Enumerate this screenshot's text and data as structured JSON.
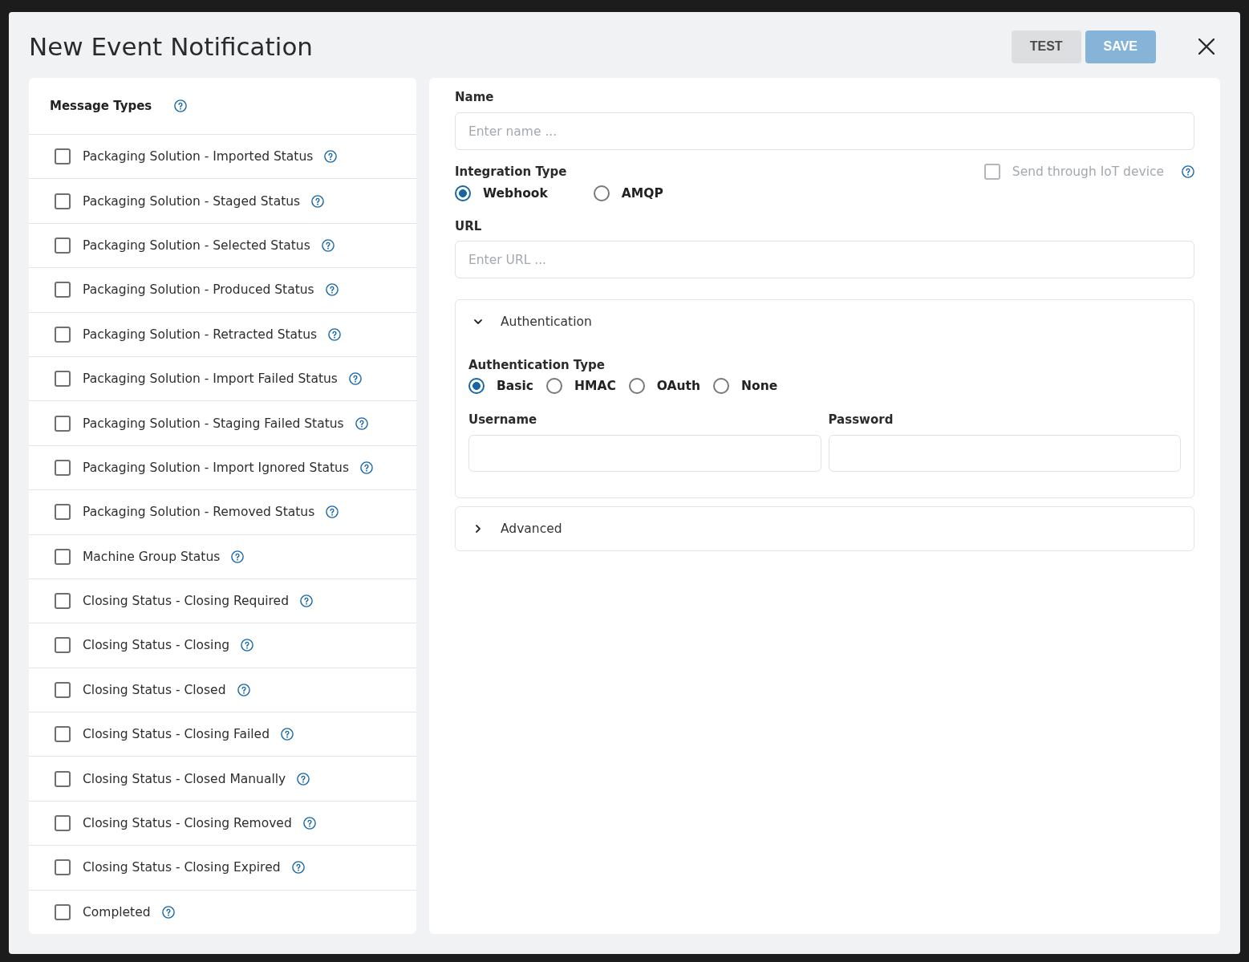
{
  "dialog": {
    "title": "New Event Notification",
    "buttons": [
      {
        "label": "TEST",
        "kind": "secondary",
        "disabled": false
      },
      {
        "label": "SAVE",
        "kind": "primary",
        "disabled": true
      }
    ]
  },
  "message_types": {
    "title": "Message Types",
    "items": [
      {
        "label": "Packaging Solution - Imported Status",
        "checked": false
      },
      {
        "label": "Packaging Solution - Staged Status",
        "checked": false
      },
      {
        "label": "Packaging Solution - Selected Status",
        "checked": false
      },
      {
        "label": "Packaging Solution - Produced Status",
        "checked": false
      },
      {
        "label": "Packaging Solution - Retracted Status",
        "checked": false
      },
      {
        "label": "Packaging Solution - Import Failed Status",
        "checked": false
      },
      {
        "label": "Packaging Solution - Staging Failed Status",
        "checked": false
      },
      {
        "label": "Packaging Solution - Import Ignored Status",
        "checked": false
      },
      {
        "label": "Packaging Solution - Removed Status",
        "checked": false
      },
      {
        "label": "Machine Group Status",
        "checked": false
      },
      {
        "label": "Closing Status - Closing Required",
        "checked": false
      },
      {
        "label": "Closing Status - Closing",
        "checked": false
      },
      {
        "label": "Closing Status - Closed",
        "checked": false
      },
      {
        "label": "Closing Status - Closing Failed",
        "checked": false
      },
      {
        "label": "Closing Status - Closed Manually",
        "checked": false
      },
      {
        "label": "Closing Status - Closing Removed",
        "checked": false
      },
      {
        "label": "Closing Status - Closing Expired",
        "checked": false
      },
      {
        "label": "Completed",
        "checked": false
      }
    ]
  },
  "form": {
    "name": {
      "label": "Name",
      "placeholder": "Enter name ..."
    },
    "integration_type": {
      "label": "Integration Type",
      "options": [
        {
          "label": "Webhook",
          "selected": true
        },
        {
          "label": "AMQP",
          "selected": false
        }
      ]
    },
    "send_through_iot": {
      "label": "Send through IoT device",
      "checked": false,
      "disabled": true
    },
    "url": {
      "label": "URL",
      "placeholder": "Enter URL ..."
    },
    "authentication": {
      "title": "Authentication",
      "expanded": true,
      "type_label": "Authentication Type",
      "options": [
        {
          "label": "Basic",
          "selected": true
        },
        {
          "label": "HMAC",
          "selected": false
        },
        {
          "label": "OAuth",
          "selected": false
        },
        {
          "label": "None",
          "selected": false
        }
      ],
      "fields": [
        {
          "label": "Username"
        },
        {
          "label": "Password"
        }
      ]
    },
    "advanced": {
      "title": "Advanced",
      "expanded": false
    }
  }
}
